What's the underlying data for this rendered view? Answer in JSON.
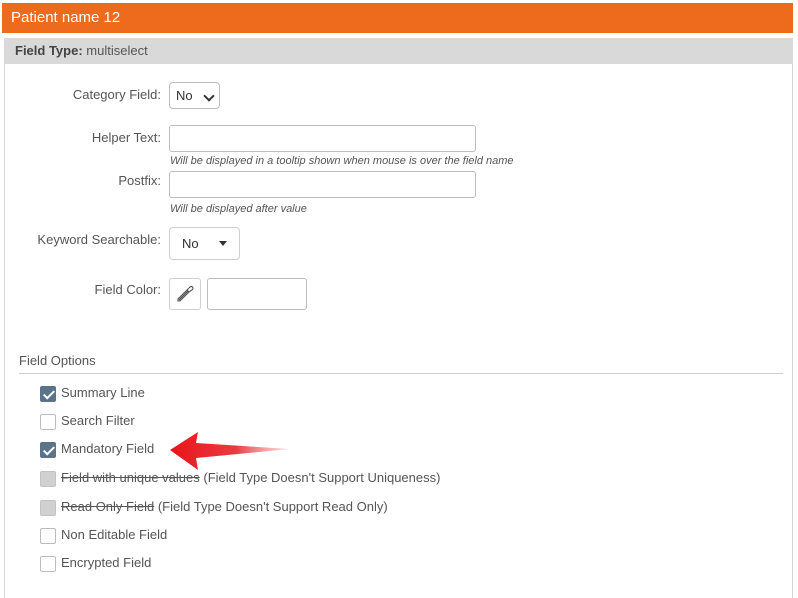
{
  "title_bar": {
    "title": "Patient name 12"
  },
  "field_type": {
    "label": "Field Type:",
    "value": "multiselect"
  },
  "form": {
    "category_field": {
      "label": "Category Field:",
      "value": "No"
    },
    "helper_text": {
      "label": "Helper Text:",
      "value": "",
      "hint": "Will be displayed in a tooltip shown when mouse is over the field name"
    },
    "postfix": {
      "label": "Postfix:",
      "value": "",
      "hint": "Will be displayed after value"
    },
    "keyword_searchable": {
      "label": "Keyword Searchable:",
      "value": "No"
    },
    "field_color": {
      "label": "Field Color:",
      "value": "",
      "icon": "eyedropper-icon"
    }
  },
  "field_options": {
    "title": "Field Options",
    "items": [
      {
        "label": "Summary Line",
        "checked": true,
        "disabled": false,
        "strike": false,
        "note": ""
      },
      {
        "label": "Search Filter",
        "checked": false,
        "disabled": false,
        "strike": false,
        "note": ""
      },
      {
        "label": "Mandatory Field",
        "checked": true,
        "disabled": false,
        "strike": false,
        "note": ""
      },
      {
        "label": "Field with unique values",
        "checked": false,
        "disabled": true,
        "strike": true,
        "note": " (Field Type Doesn't Support Uniqueness)"
      },
      {
        "label": "Read Only Field",
        "checked": false,
        "disabled": true,
        "strike": true,
        "note": " (Field Type Doesn't Support Read Only)"
      },
      {
        "label": "Non Editable Field",
        "checked": false,
        "disabled": false,
        "strike": false,
        "note": ""
      },
      {
        "label": "Encrypted Field",
        "checked": false,
        "disabled": false,
        "strike": false,
        "note": ""
      }
    ]
  },
  "annotation": {
    "icon": "red-arrow-icon",
    "color": "#e8141b"
  }
}
